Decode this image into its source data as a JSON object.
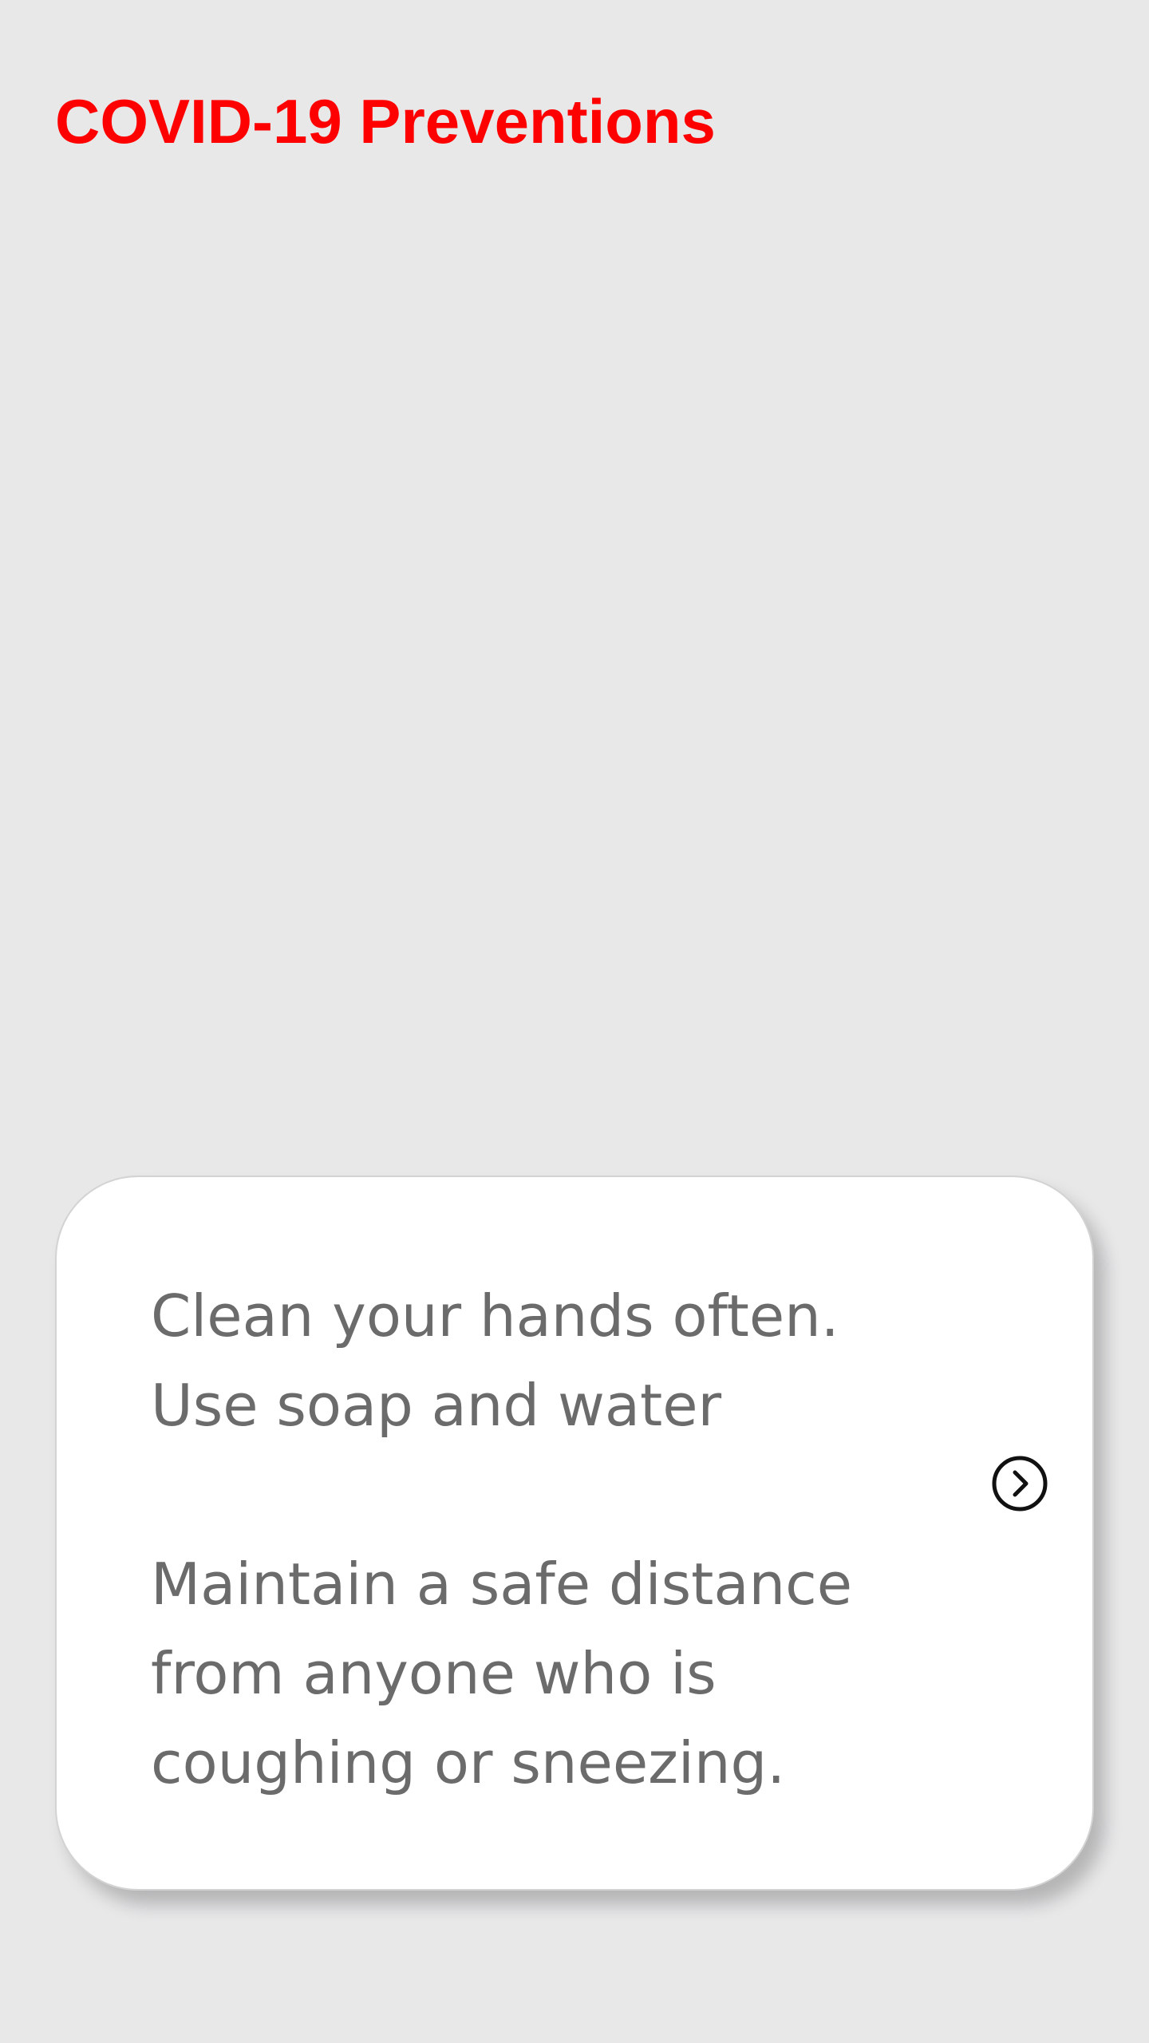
{
  "header": {
    "title": "COVID-19 Preventions"
  },
  "card": {
    "tips": [
      {
        "line1": "Clean your hands often.",
        "line2": "Use soap and water"
      },
      {
        "line1": "Maintain a safe distance",
        "line2": "from anyone who is",
        "line3": "coughing or sneezing."
      }
    ],
    "next_icon": "chevron-right-circle-icon"
  },
  "colors": {
    "background": "#e8e8e9",
    "title": "#ff0000",
    "card": "#ffffff",
    "tip_text": "#6b6b6b",
    "icon": "#111111"
  }
}
